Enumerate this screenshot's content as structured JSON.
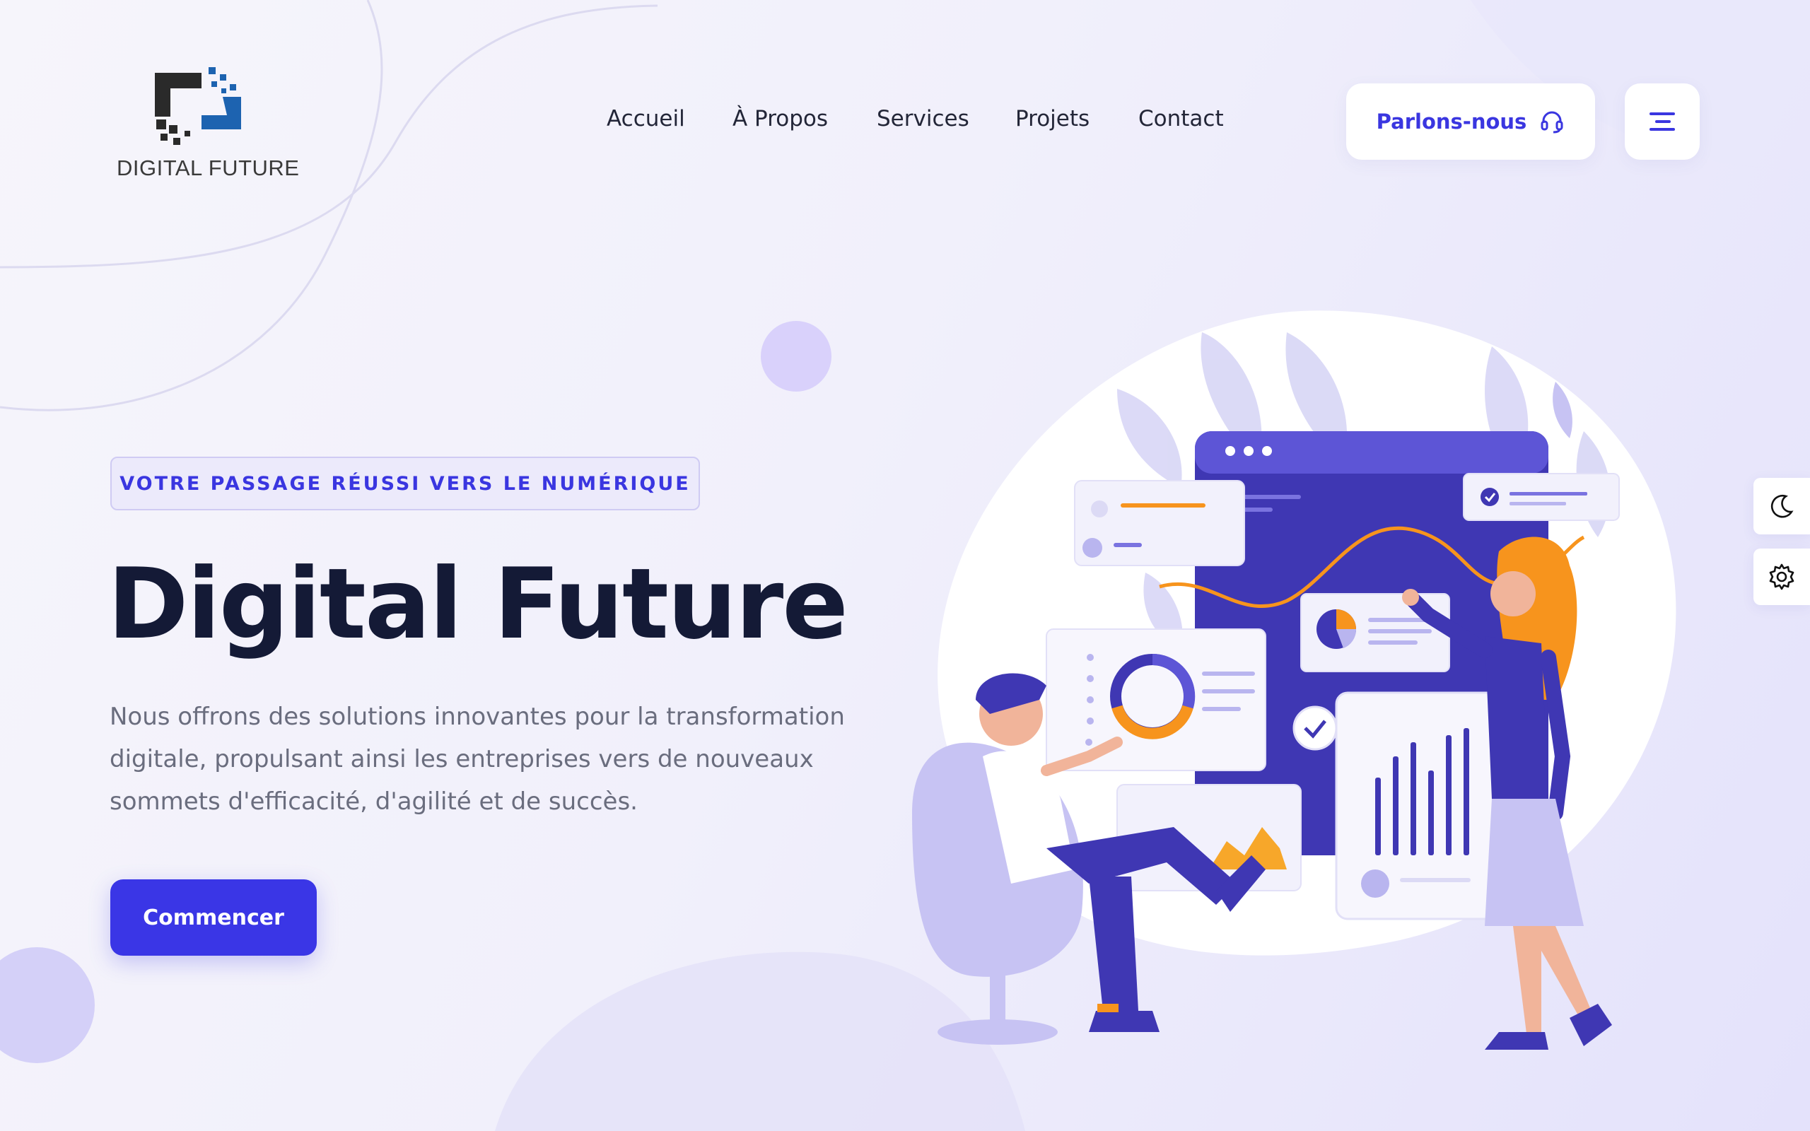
{
  "brand": {
    "logo_text": "DIGITAL FUTURE"
  },
  "nav": {
    "items": [
      {
        "label": "Accueil"
      },
      {
        "label": "À Propos"
      },
      {
        "label": "Services"
      },
      {
        "label": "Projets"
      },
      {
        "label": "Contact"
      }
    ]
  },
  "header": {
    "cta_label": "Parlons-nous",
    "cta_icon": "headset-icon",
    "menu_icon": "hamburger-menu-icon"
  },
  "side_tools": {
    "theme_icon": "moon-icon",
    "settings_icon": "gear-icon"
  },
  "hero": {
    "tagline": "VOTRE PASSAGE RÉUSSI VERS LE NUMÉRIQUE",
    "title": "Digital Future",
    "description": "Nous offrons des solutions innovantes pour la transformation digitale, propulsant ainsi les entreprises vers de nouveaux sommets d'efficacité, d'agilité et de succès.",
    "button_label": "Commencer"
  },
  "colors": {
    "accent": "#3a36e6",
    "title": "#141a36",
    "text_muted": "#6a6d7e",
    "illustration_purple": "#3f37b3",
    "illustration_orange": "#f7941d"
  }
}
